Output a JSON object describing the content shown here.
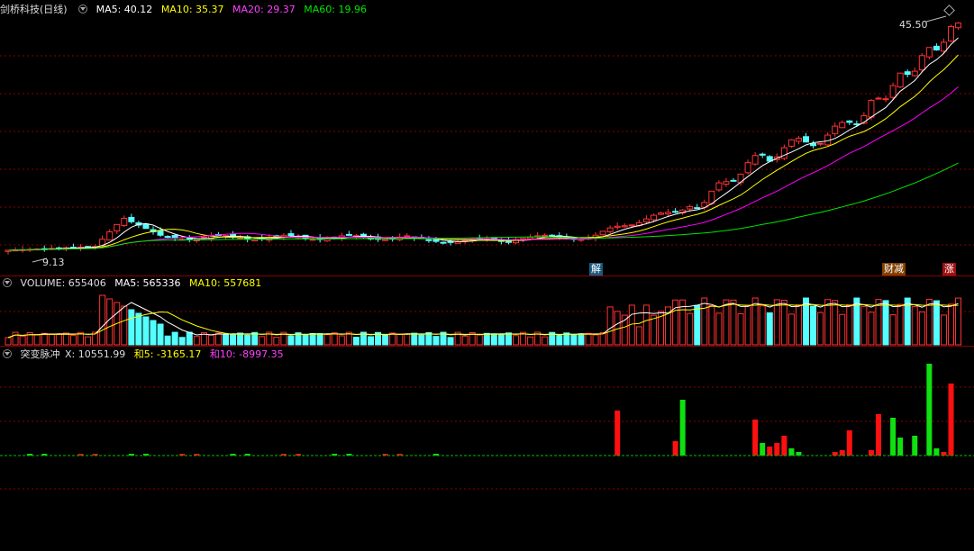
{
  "stock": {
    "name": "剑桥科技",
    "period": "(日线)"
  },
  "main_header": {
    "ma5": "MA5: 40.12",
    "ma10": "MA10: 35.37",
    "ma20": "MA20: 29.37",
    "ma60": "MA60: 19.96"
  },
  "labels": {
    "high_price": "45.50",
    "low_price": "9.13"
  },
  "markers": {
    "jie": "解",
    "caijian": "财减",
    "zhang": "涨"
  },
  "volume_header": {
    "volume": "VOLUME: 655406",
    "ma5": "MA5: 565336",
    "ma10": "MA10: 557681"
  },
  "indicator_header": {
    "name": "突变脉冲",
    "x": "X: 10551.99",
    "he5": "和5: -3165.17",
    "he10": "和10: -8997.35"
  },
  "colors": {
    "up": "#ff3232",
    "down": "#54ffff",
    "ma5": "#ffffff",
    "ma10": "#ffff00",
    "ma20": "#ff00ff",
    "ma60": "#00e600",
    "grid": "#8b0000"
  }
}
